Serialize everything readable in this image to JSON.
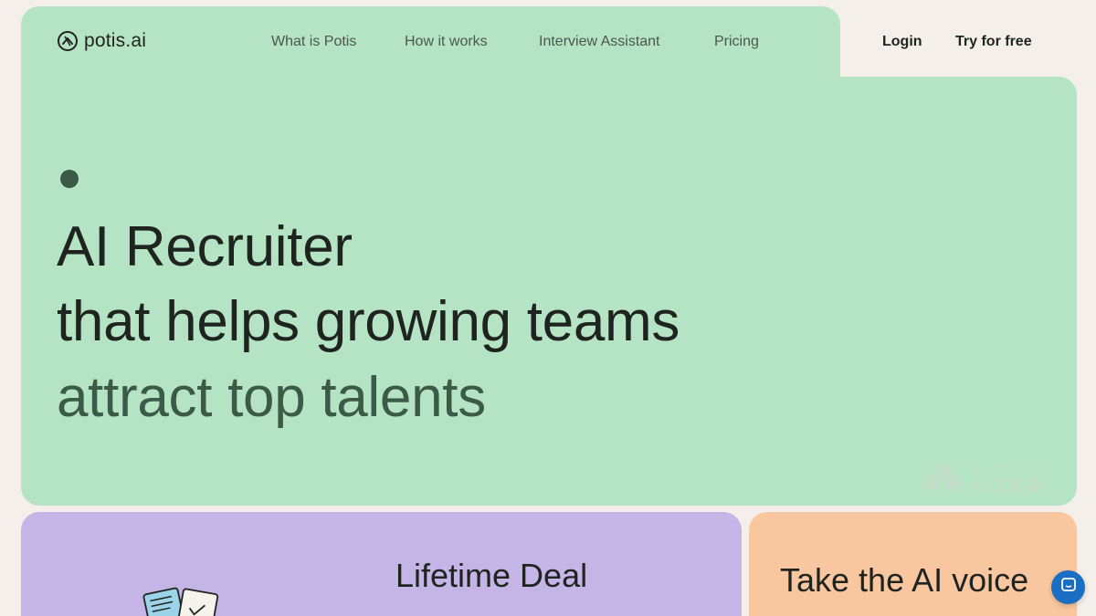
{
  "brand": {
    "name": "potis.ai"
  },
  "nav": {
    "links": [
      "What is Potis",
      "How it works",
      "Interview Assistant",
      "Pricing"
    ],
    "login": "Login",
    "try_free": "Try for free"
  },
  "hero": {
    "line1": "AI Recruiter",
    "line2": "that helps growing teams",
    "line3": "attract top talents"
  },
  "cards": {
    "deal_title": "Lifetime Deal",
    "voice_title": "Take the AI voice"
  },
  "watermark": {
    "domain": "ai-bot.cn",
    "label": "AI工具集"
  },
  "colors": {
    "hero_bg": "#b5e4c4",
    "accent_dark_green": "#3b5a47",
    "purple_card": "#c4b5e6",
    "orange_card": "#f9c79f",
    "page_bg": "#f4efea",
    "chat_blue": "#1a6ec4"
  },
  "icons": [
    "potis-logo-icon",
    "documents-illustration",
    "chat-icon",
    "watermark-logo-icon"
  ]
}
